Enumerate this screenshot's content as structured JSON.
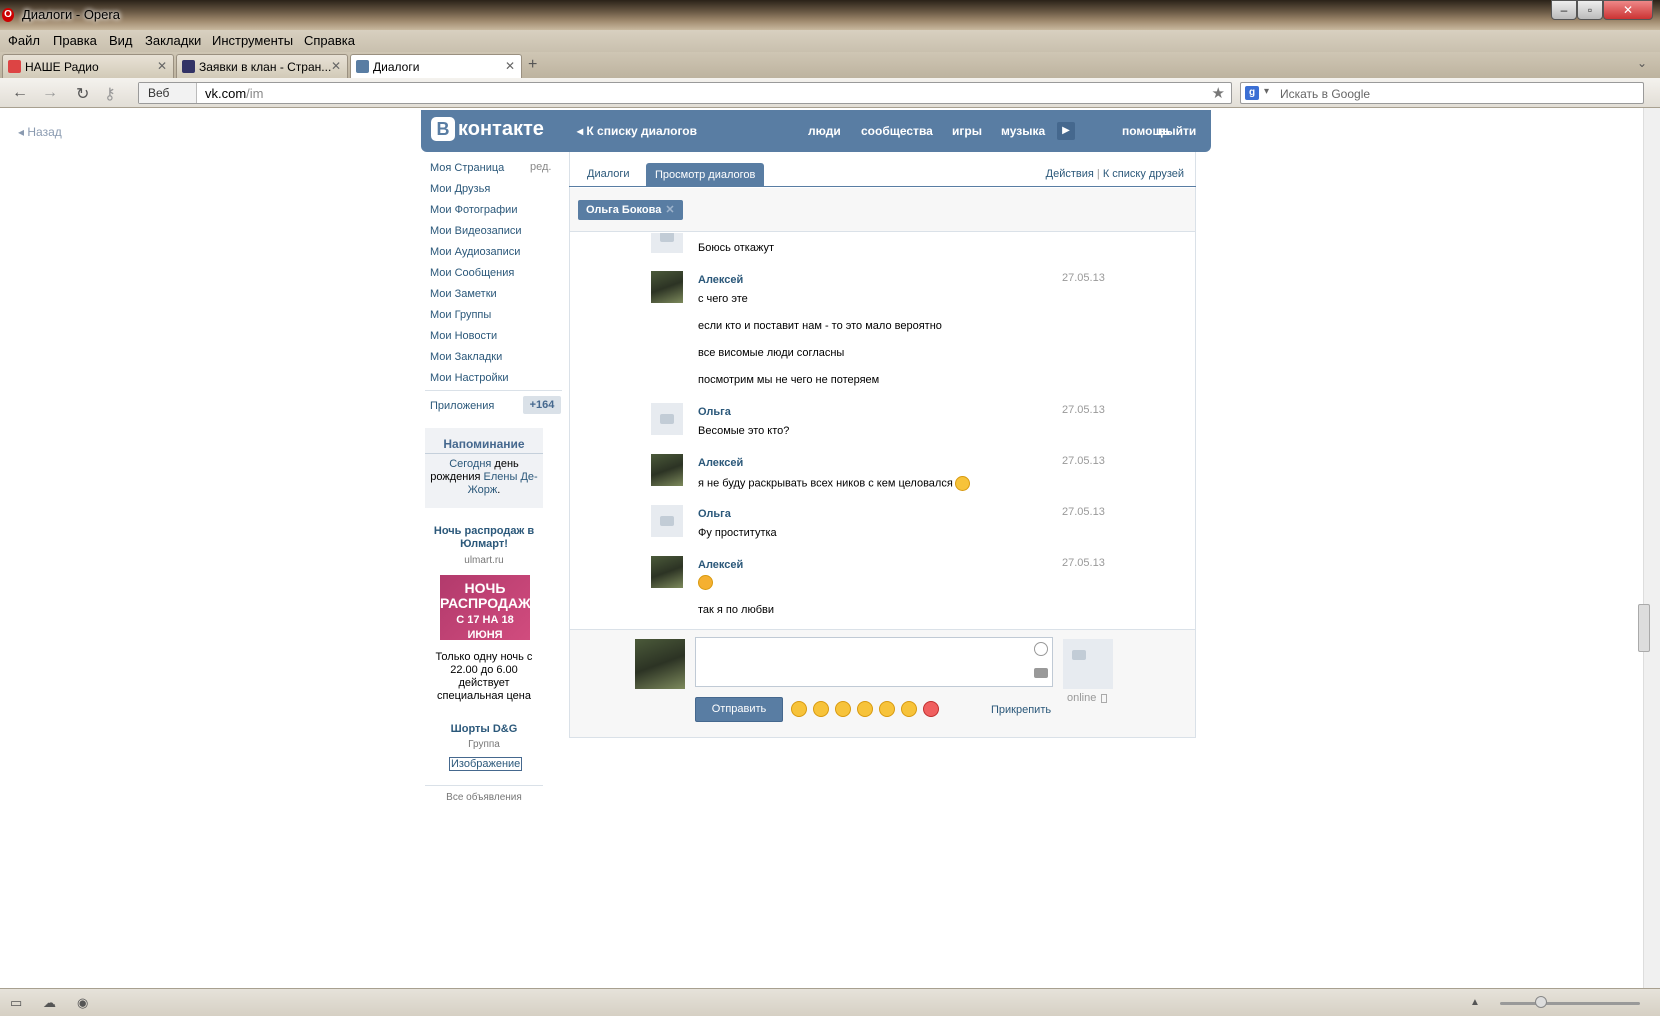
{
  "window": {
    "title": "Диалоги - Opera"
  },
  "menu": [
    "Файл",
    "Правка",
    "Вид",
    "Закладки",
    "Инструменты",
    "Справка"
  ],
  "tabs": [
    {
      "label": "НАШЕ Радио"
    },
    {
      "label": "Заявки в клан - Стран..."
    },
    {
      "label": "Диалоги"
    }
  ],
  "address": {
    "scope": "Веб",
    "host": "vk.com",
    "path": "/im"
  },
  "search": {
    "placeholder": "Искать в Google"
  },
  "back_label": "Назад",
  "vk": {
    "logo_letter": "В",
    "logo_text": "контакте",
    "back_to_dialogs": "К списку диалогов",
    "nav": [
      "люди",
      "сообщества",
      "игры",
      "музыка",
      "помощь",
      "выйти"
    ]
  },
  "sidebar": {
    "items": [
      "Моя Страница",
      "Мои Друзья",
      "Мои Фотографии",
      "Мои Видеозаписи",
      "Мои Аудиозаписи",
      "Мои Сообщения",
      "Мои Заметки",
      "Мои Группы",
      "Мои Новости",
      "Мои Закладки",
      "Мои Настройки"
    ],
    "edit": "ред.",
    "apps": "Приложения",
    "apps_badge": "+164"
  },
  "reminder": {
    "title": "Напоминание",
    "today": "Сегодня",
    "text1": " день рождения ",
    "name": "Елены Де-Жорж",
    "end": "."
  },
  "ads": {
    "title": "Ночь распродаж в Юлмарт!",
    "domain": "ulmart.ru",
    "image_line1": "НОЧЬ",
    "image_line2": "РАСПРОДАЖ",
    "image_line3": "С 17 НА 18 ИЮНЯ",
    "body": "Только одну ночь с 22.00 до 6.00 действует специальная цена",
    "group_title": "Шорты D&G",
    "group_sub": "Группа",
    "image_link": "Изображение",
    "all": "Все объявления"
  },
  "dialog_tabs": {
    "tab1": "Диалоги",
    "tab2": "Просмотр диалогов",
    "actions": "Действия",
    "sep": "|",
    "friends": "К списку друзей"
  },
  "peer": {
    "name": "Ольга Бокова",
    "close": "✕"
  },
  "messages": [
    {
      "text": "Боюсь откажут"
    },
    {
      "name": "Алексей",
      "date": "27.05.13",
      "lines": [
        "с чего эте",
        "если кто и поставит нам - то это мало вероятно",
        "все висомые люди согласны",
        "посмотрим мы не чего не потеряем"
      ]
    },
    {
      "name": "Ольга",
      "date": "27.05.13",
      "lines": [
        "Весомые это кто?"
      ]
    },
    {
      "name": "Алексей",
      "date": "27.05.13",
      "lines": [
        "я не буду раскрывать всех ников с кем целовался"
      ]
    },
    {
      "name": "Ольга",
      "date": "27.05.13",
      "lines": [
        "Фу проститутка"
      ]
    },
    {
      "name": "Алексей",
      "date": "27.05.13",
      "lines": [
        "",
        "так я по любви"
      ]
    }
  ],
  "compose": {
    "send": "Отправить",
    "attach": "Прикрепить",
    "online": "online"
  }
}
